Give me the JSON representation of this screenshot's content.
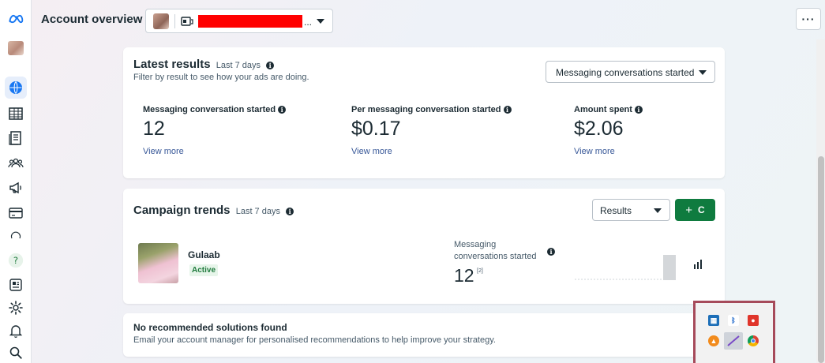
{
  "header": {
    "title": "Account overview",
    "account_name_suffix": "...",
    "more_label": "···"
  },
  "latest_results": {
    "title": "Latest results",
    "period": "Last 7 days",
    "subtitle": "Filter by result to see how your ads are doing.",
    "filter_value": "Messaging conversations started",
    "metrics": [
      {
        "label": "Messaging conversation started",
        "value": "12",
        "link": "View more"
      },
      {
        "label": "Per messaging conversation started",
        "value": "$0.17",
        "link": "View more"
      },
      {
        "label": "Amount spent",
        "value": "$2.06",
        "link": "View more"
      }
    ]
  },
  "campaign_trends": {
    "title": "Campaign trends",
    "period": "Last 7 days",
    "metric_select": "Results",
    "create_label": "C",
    "campaign": {
      "name": "Gulaab",
      "status": "Active",
      "metric_label": "Messaging conversations started",
      "metric_value": "12",
      "footnote": "[2]",
      "sparkline": [
        0,
        0,
        0,
        0,
        0,
        0,
        12
      ]
    }
  },
  "recommendations": {
    "title": "No recommended solutions found",
    "body": "Email your account manager for personalised recommendations to help improve your strategy."
  },
  "colors": {
    "accent_blue": "#1877f2",
    "create_green": "#0f7b3f",
    "active_green": "#1e7a3c",
    "tray_border": "#a64a5a"
  },
  "rail_icons": [
    "meta-logo-icon",
    "profile-avatar",
    "overview-icon",
    "table-icon",
    "pages-icon",
    "audience-icon",
    "campaigns-icon",
    "billing-icon",
    "loading-icon",
    "help-icon",
    "news-icon",
    "settings-icon",
    "notifications-icon",
    "search-icon"
  ],
  "tray_icons": [
    "app-icon",
    "bluetooth-icon",
    "record-icon",
    "vlc-icon",
    "pen-icon",
    "chrome-icon"
  ]
}
